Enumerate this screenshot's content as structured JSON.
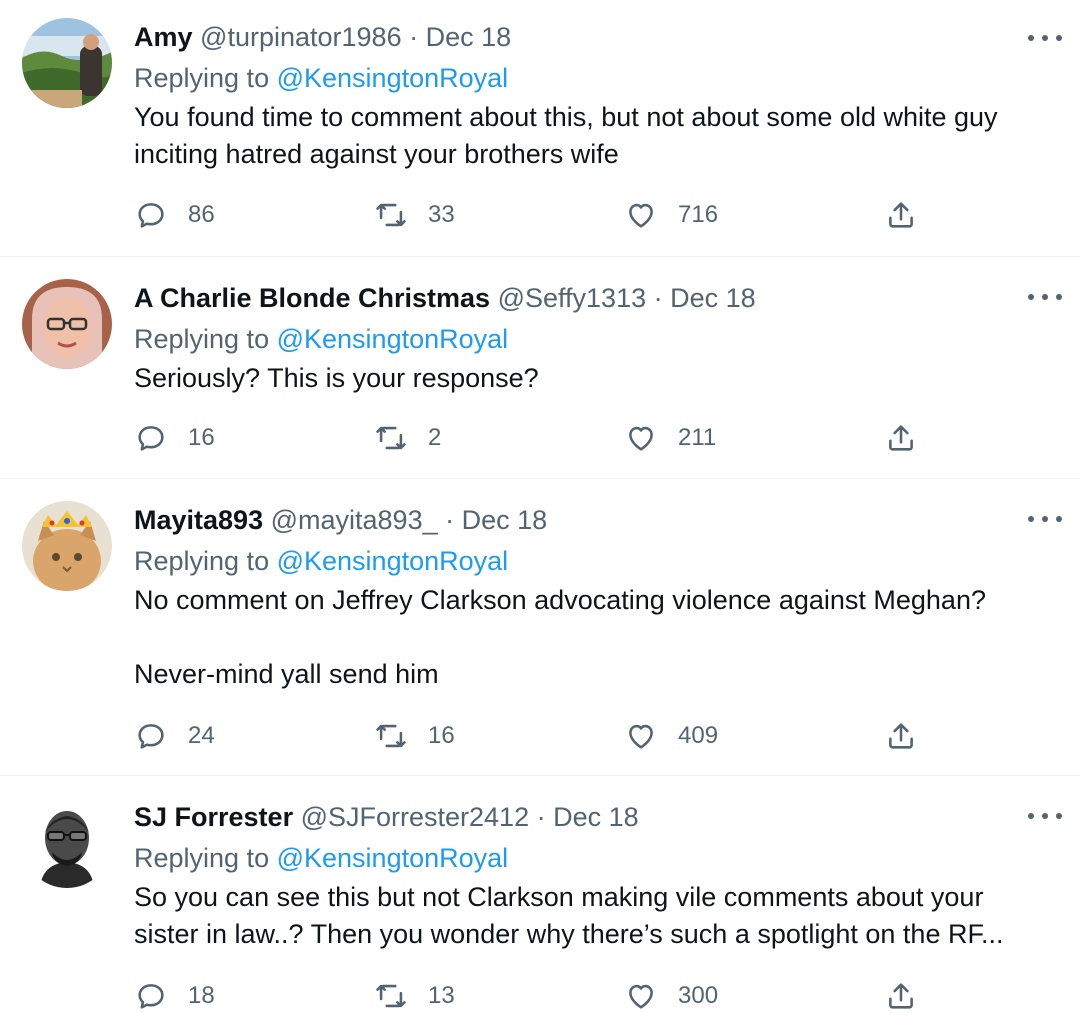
{
  "tweets": [
    {
      "name": "Amy",
      "handle": "@turpinator1986",
      "separator": "·",
      "date": "Dec 18",
      "replying_prefix": "Replying to",
      "replying_to": "@KensingtonRoyal",
      "text_lines": [
        "You found time to comment about this, but not about some old white guy",
        "inciting hatred against your brothers wife"
      ],
      "replies": "86",
      "retweets": "33",
      "likes": "716",
      "avatar_icon": "avatar-photo"
    },
    {
      "name": "A Charlie Blonde Christmas",
      "handle": "@Seffy1313",
      "separator": "·",
      "date": "Dec 18",
      "replying_prefix": "Replying to",
      "replying_to": "@KensingtonRoyal",
      "text_lines": [
        "Seriously? This is your response?"
      ],
      "replies": "16",
      "retweets": "2",
      "likes": "211",
      "avatar_icon": "avatar-photo"
    },
    {
      "name": "Mayita893",
      "handle": "@mayita893_",
      "separator": "·",
      "date": "Dec 18",
      "replying_prefix": "Replying to",
      "replying_to": "@KensingtonRoyal",
      "text_lines": [
        "No comment on Jeffrey Clarkson advocating violence against Meghan?",
        "",
        "Never-mind yall send him"
      ],
      "replies": "24",
      "retweets": "16",
      "likes": "409",
      "avatar_icon": "avatar-photo"
    },
    {
      "name": "SJ Forrester",
      "handle": "@SJForrester2412",
      "separator": "·",
      "date": "Dec 18",
      "replying_prefix": "Replying to",
      "replying_to": "@KensingtonRoyal",
      "text_lines": [
        "So you can see this but not Clarkson making vile comments about your",
        "sister in law..? Then you wonder why there’s such a spotlight on the RF..."
      ],
      "replies": "18",
      "retweets": "13",
      "likes": "300",
      "avatar_icon": "avatar-photo"
    }
  ],
  "colors": {
    "text": "#0f1419",
    "secondary": "#536471",
    "link": "#1d9bf0",
    "divider": "#eff3f4"
  }
}
